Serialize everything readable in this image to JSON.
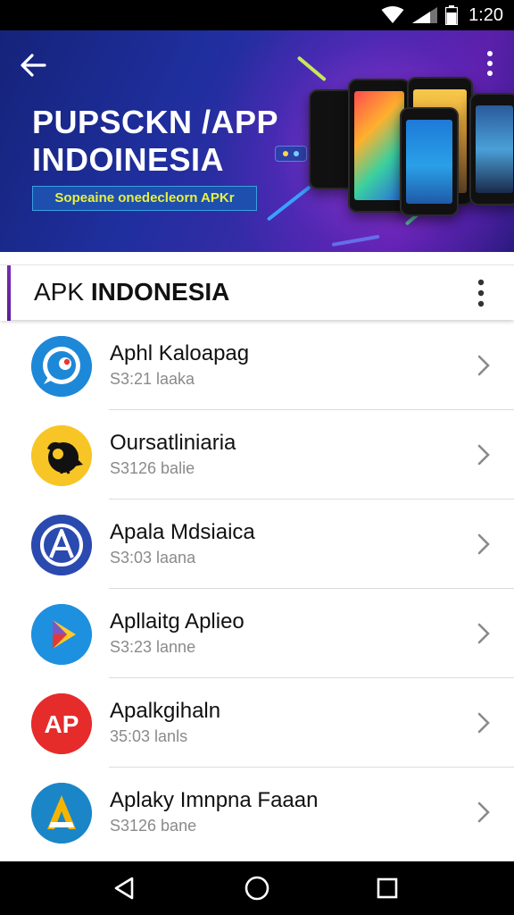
{
  "status_bar": {
    "time": "1:20",
    "icons": [
      "wifi-icon",
      "signal-icon",
      "battery-icon"
    ]
  },
  "banner": {
    "title_line1": "PUPSCKN /APP",
    "title_line2": "INDOINESIA",
    "tagline": "Sopeaine onedecleorn APKr",
    "icons": [
      "back-arrow-icon",
      "more-vert-icon"
    ]
  },
  "section": {
    "title_light": "APK ",
    "title_bold": "INDONESIA",
    "icons": [
      "more-vert-icon"
    ]
  },
  "apps": [
    {
      "name": "Aphl Kaloapag",
      "sub": "S3:21 laaka",
      "icon": "chat-bubble-icon",
      "colors": [
        "#1e88d8",
        "#ffffff",
        "#e53935"
      ]
    },
    {
      "name": "Oursatliniaria",
      "sub": "S3126 balie",
      "icon": "bird-icon",
      "colors": [
        "#f7c525",
        "#111111"
      ]
    },
    {
      "name": "Apala Mdsiaica",
      "sub": "S3:03 laana",
      "icon": "compass-a-icon",
      "colors": [
        "#2a4ab0",
        "#ffffff"
      ]
    },
    {
      "name": "Apllaitg Aplieo",
      "sub": "S3:23 lanne",
      "icon": "play-store-icon",
      "colors": [
        "#1e90e0",
        "#ffca28",
        "#e53935",
        "#43a047"
      ]
    },
    {
      "name": "Apalkgihaln",
      "sub": "35:03 lanls",
      "icon": "ap-logo-icon",
      "colors": [
        "#e62b2b",
        "#ffffff"
      ]
    },
    {
      "name": "Aplaky Imnpna Faaan",
      "sub": "S3126 bane",
      "icon": "a-letter-icon",
      "colors": [
        "#1a86c8",
        "#f5b400",
        "#ffffff"
      ]
    }
  ],
  "nav_bar": {
    "icons": [
      "nav-back-icon",
      "nav-home-icon",
      "nav-recents-icon"
    ]
  },
  "colors": {
    "banner_start": "#15237a",
    "banner_end": "#5a1fa8",
    "accent_purple": "#7a2bb0",
    "tagline_text": "#e8f040",
    "tagline_bg": "#1e4fae"
  }
}
